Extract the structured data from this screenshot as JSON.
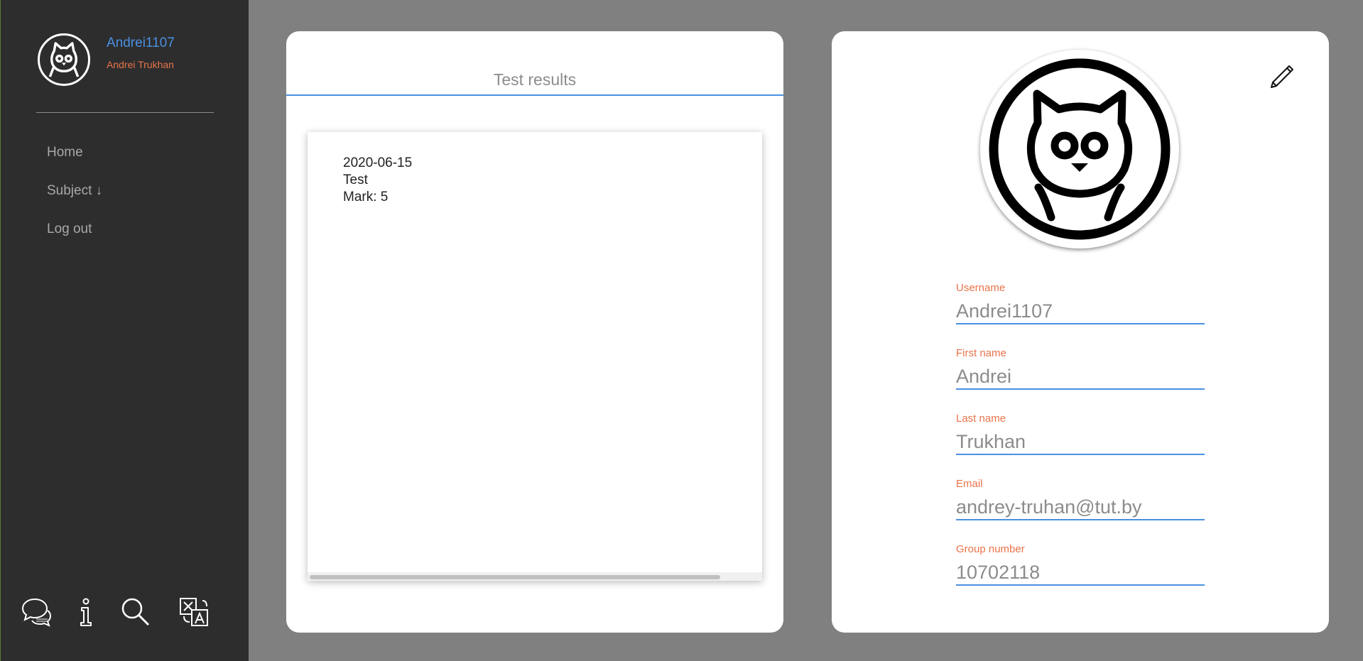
{
  "sidebar": {
    "username": "Andrei1107",
    "full_name": "Andrei Trukhan",
    "nav": [
      {
        "label": "Home"
      },
      {
        "label": "Subject ↓"
      },
      {
        "label": "Log out"
      }
    ],
    "tools": [
      "chat-icon",
      "info-icon",
      "search-icon",
      "translate-icon"
    ]
  },
  "results": {
    "tab_title": "Test results",
    "items": [
      {
        "date": "2020-06-15",
        "name": "Test",
        "mark": "Mark: 5"
      }
    ]
  },
  "profile": {
    "fields": [
      {
        "label": "Username",
        "value": "Andrei1107"
      },
      {
        "label": "First name",
        "value": "Andrei"
      },
      {
        "label": "Last name",
        "value": "Trukhan"
      },
      {
        "label": "Email",
        "value": "andrey-truhan@tut.by"
      },
      {
        "label": "Group number",
        "value": "10702118"
      }
    ]
  },
  "colors": {
    "accent_blue": "#4a90e2",
    "accent_orange": "#e8734a",
    "sidebar_bg": "#2d2d2d",
    "page_bg": "#808080"
  }
}
